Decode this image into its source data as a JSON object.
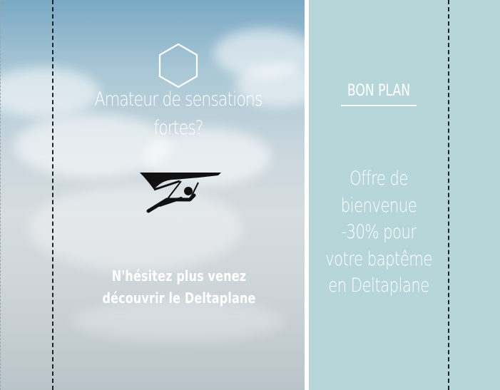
{
  "left_panel": {
    "headline_lines": [
      "Amateur de sensations",
      "fortes?"
    ],
    "cta_lines": [
      "N'hésitez plus venez",
      "découvrir le Deltaplane"
    ],
    "icons": [
      "hexagon-outline-icon",
      "hang-glider-icon"
    ]
  },
  "right_panel": {
    "heading": "BON PLAN",
    "offer_lines": [
      "Offre de",
      "bienvenue",
      "-30% pour",
      "votre baptême",
      "en Deltaplane"
    ]
  },
  "colors": {
    "sky_top": "#7aa9c4",
    "right_panel_bg": "#b7d6da",
    "text": "#ffffff",
    "dash": "#1d2226"
  }
}
